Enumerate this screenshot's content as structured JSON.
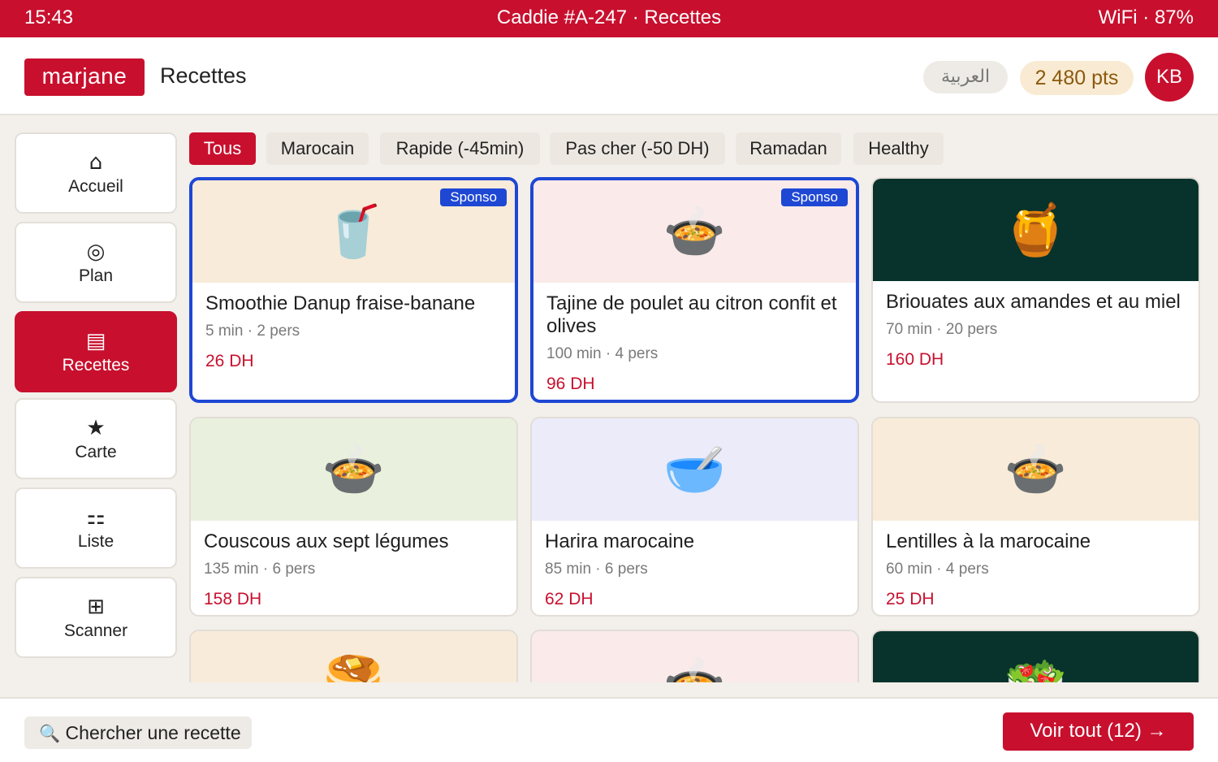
{
  "status_bar": {
    "time": "15:43",
    "title": "Caddie #A-247 · Recettes",
    "connectivity": "WiFi · 87%"
  },
  "header": {
    "logo": "marjane",
    "title": "Recettes",
    "language_button": "العربية",
    "points": "2 480 pts",
    "avatar_initials": "KB"
  },
  "sidebar": {
    "items": [
      {
        "label": "Accueil",
        "icon": "home-icon",
        "glyph": "⌂",
        "active": false
      },
      {
        "label": "Plan",
        "icon": "map-target-icon",
        "glyph": "◎",
        "active": false
      },
      {
        "label": "Recettes",
        "icon": "recipes-list-icon",
        "glyph": "▤",
        "active": true
      },
      {
        "label": "Carte",
        "icon": "star-icon",
        "glyph": "★",
        "active": false
      },
      {
        "label": "Liste",
        "icon": "list-icon",
        "glyph": "⚏",
        "active": false
      },
      {
        "label": "Scanner",
        "icon": "scanner-icon",
        "glyph": "⊞",
        "active": false
      }
    ]
  },
  "filters": [
    {
      "label": "Tous",
      "active": true
    },
    {
      "label": "Marocain",
      "active": false
    },
    {
      "label": "Rapide (-45min)",
      "active": false
    },
    {
      "label": "Pas cher (-50 DH)",
      "active": false
    },
    {
      "label": "Ramadan",
      "active": false
    },
    {
      "label": "Healthy",
      "active": false
    }
  ],
  "recipes": [
    {
      "name": "Smoothie Danup fraise-banane",
      "meta": "5 min · 2 pers",
      "price": "26 DH",
      "sponsored": true,
      "badge": "Sponso",
      "emoji": "🥤",
      "image_icon": "drink-cup-icon",
      "thumb_color": "#f8ebd9"
    },
    {
      "name": "Tajine de poulet au citron confit et olives",
      "meta": "100 min · 4 pers",
      "price": "96 DH",
      "sponsored": true,
      "badge": "Sponso",
      "emoji": "🍲",
      "image_icon": "stew-pot-icon",
      "thumb_color": "#faeaea"
    },
    {
      "name": "Briouates aux amandes et au miel",
      "meta": "70 min · 20 pers",
      "price": "160 DH",
      "sponsored": false,
      "badge": "",
      "emoji": "🍯",
      "image_icon": "honey-pot-icon",
      "thumb_color": "#08332c"
    },
    {
      "name": "Couscous aux sept légumes",
      "meta": "135 min · 6 pers",
      "price": "158 DH",
      "sponsored": false,
      "badge": "",
      "emoji": "🍲",
      "image_icon": "stew-pot-icon",
      "thumb_color": "#e9f1de"
    },
    {
      "name": "Harira marocaine",
      "meta": "85 min · 6 pers",
      "price": "62 DH",
      "sponsored": false,
      "badge": "",
      "emoji": "🥣",
      "image_icon": "soup-bowl-icon",
      "thumb_color": "#ebebfa"
    },
    {
      "name": "Lentilles à la marocaine",
      "meta": "60 min · 4 pers",
      "price": "25 DH",
      "sponsored": false,
      "badge": "",
      "emoji": "🍲",
      "image_icon": "stew-pot-icon",
      "thumb_color": "#f8ebd9"
    },
    {
      "name": "",
      "meta": "",
      "price": "",
      "sponsored": false,
      "badge": "",
      "emoji": "🥞",
      "image_icon": "pancakes-icon",
      "thumb_color": "#f8ebd9"
    },
    {
      "name": "",
      "meta": "",
      "price": "",
      "sponsored": false,
      "badge": "",
      "emoji": "🍲",
      "image_icon": "stew-pot-icon",
      "thumb_color": "#faeaea"
    },
    {
      "name": "",
      "meta": "",
      "price": "",
      "sponsored": false,
      "badge": "",
      "emoji": "🥗",
      "image_icon": "salad-icon",
      "thumb_color": "#08332c"
    }
  ],
  "bottom_bar": {
    "search_icon": "🔍",
    "search_placeholder": "Chercher une recette",
    "see_all_label": "Voir tout (12) →"
  },
  "colors": {
    "brand": "#c8102e",
    "sponsored_border": "#1e47d4",
    "background": "#f3f0eb"
  }
}
